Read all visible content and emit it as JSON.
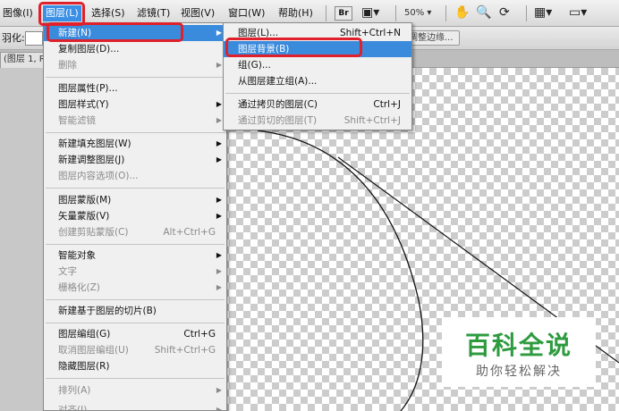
{
  "menubar": {
    "items": [
      "图像(I)",
      "图层(L)",
      "选择(S)",
      "滤镜(T)",
      "视图(V)",
      "窗口(W)",
      "帮助(H)"
    ],
    "bridge_label": "Br",
    "zoom": "50%"
  },
  "options": {
    "feather_label": "羽化:",
    "refine_edge_label": "调整边缘..."
  },
  "document": {
    "tab_label": "(图层 1, R"
  },
  "layer_menu": {
    "items": [
      {
        "label": "新建(N)",
        "submenu": true
      },
      {
        "label": "复制图层(D)..."
      },
      {
        "label": "删除",
        "submenu": true,
        "disabled": true
      },
      {
        "label": "图层属性(P)..."
      },
      {
        "label": "图层样式(Y)",
        "submenu": true
      },
      {
        "label": "智能滤镜",
        "submenu": true,
        "disabled": true
      },
      {
        "label": "新建填充图层(W)",
        "submenu": true
      },
      {
        "label": "新建调整图层(J)",
        "submenu": true
      },
      {
        "label": "图层内容选项(O)...",
        "disabled": true
      },
      {
        "label": "图层蒙版(M)",
        "submenu": true
      },
      {
        "label": "矢量蒙版(V)",
        "submenu": true
      },
      {
        "label": "创建剪贴蒙版(C)",
        "shortcut": "Alt+Ctrl+G",
        "disabled": true
      },
      {
        "label": "智能对象",
        "submenu": true
      },
      {
        "label": "文字",
        "submenu": true,
        "disabled": true
      },
      {
        "label": "栅格化(Z)",
        "submenu": true,
        "disabled": true
      },
      {
        "label": "新建基于图层的切片(B)"
      },
      {
        "label": "图层编组(G)",
        "shortcut": "Ctrl+G"
      },
      {
        "label": "取消图层编组(U)",
        "shortcut": "Shift+Ctrl+G",
        "disabled": true
      },
      {
        "label": "隐藏图层(R)"
      },
      {
        "label": "排列(A)",
        "submenu": true,
        "disabled": true
      },
      {
        "label": "对齐(I)",
        "submenu": true,
        "disabled": true
      }
    ]
  },
  "new_submenu": {
    "items": [
      {
        "label": "图层(L)...",
        "shortcut": "Shift+Ctrl+N"
      },
      {
        "label": "图层背景(B)"
      },
      {
        "label": "组(G)..."
      },
      {
        "label": "从图层建立组(A)..."
      },
      {
        "label": "通过拷贝的图层(C)",
        "shortcut": "Ctrl+J"
      },
      {
        "label": "通过剪切的图层(T)",
        "shortcut": "Shift+Ctrl+J",
        "disabled": true
      }
    ]
  },
  "watermark": {
    "title": "百科全说",
    "subtitle": "助你轻松解决"
  },
  "colors": {
    "highlight": "#3b8bdd",
    "annotation_red": "#e0202a",
    "watermark_green": "#2e9b3f"
  },
  "icons": [
    "screen-mode-icon",
    "hand-icon",
    "zoom-icon",
    "rotate-view-icon",
    "arrange-documents-icon",
    "screen-layout-icon"
  ]
}
